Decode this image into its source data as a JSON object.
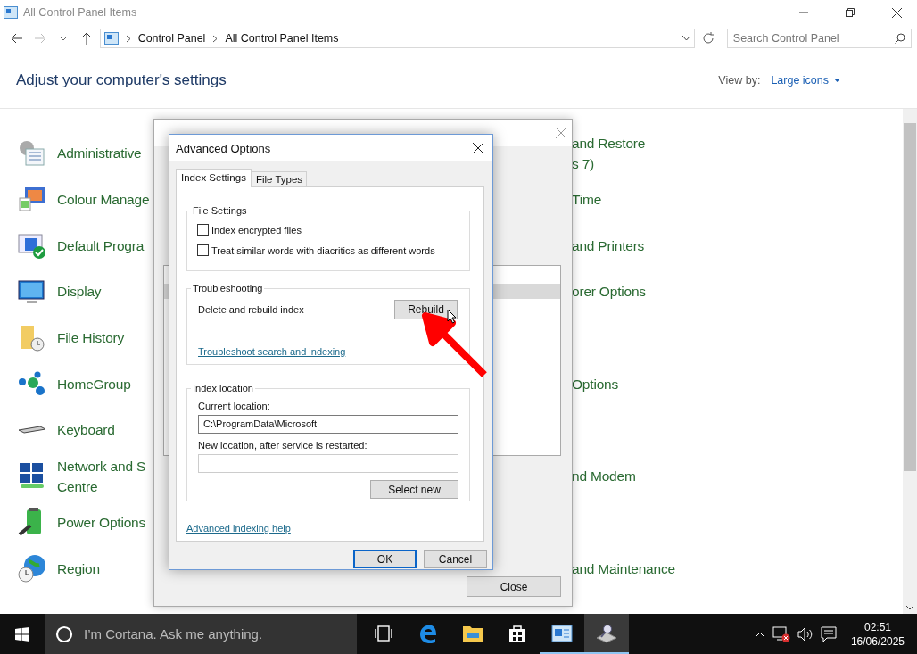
{
  "window": {
    "title": "All Control Panel Items"
  },
  "address_bar": {
    "breadcrumbs": [
      "Control Panel",
      "All Control Panel Items"
    ]
  },
  "search": {
    "placeholder": "Search Control Panel"
  },
  "header": {
    "title": "Adjust your computer's settings",
    "view_by_label": "View by:",
    "view_by_value": "Large icons"
  },
  "rows": [
    {
      "left": {
        "kind": "admin",
        "lines": [
          "Administrative"
        ]
      },
      "right": {
        "lines": [
          "and Restore",
          "s 7)"
        ]
      }
    },
    {
      "left": {
        "kind": "colour",
        "lines": [
          "Colour Manage"
        ]
      },
      "right": {
        "lines": [
          "Time"
        ]
      }
    },
    {
      "left": {
        "kind": "default",
        "lines": [
          "Default Progra"
        ]
      },
      "right": {
        "lines": [
          "and Printers"
        ]
      }
    },
    {
      "left": {
        "kind": "display",
        "lines": [
          "Display"
        ]
      },
      "right": {
        "lines": [
          "orer Options"
        ]
      }
    },
    {
      "left": {
        "kind": "history",
        "lines": [
          "File History"
        ]
      }
    },
    {
      "left": {
        "kind": "homegroup",
        "lines": [
          "HomeGroup"
        ]
      },
      "right": {
        "lines": [
          "Options"
        ]
      }
    },
    {
      "left": {
        "kind": "keyboard",
        "lines": [
          "Keyboard"
        ]
      }
    },
    {
      "left": {
        "kind": "network",
        "lines": [
          "Network and S",
          "Centre"
        ]
      },
      "right": {
        "lines": [
          "nd Modem"
        ]
      }
    },
    {
      "left": {
        "kind": "power",
        "lines": [
          "Power Options"
        ]
      }
    },
    {
      "left": {
        "kind": "region",
        "lines": [
          "Region"
        ]
      },
      "right": {
        "lines": [
          "and Maintenance"
        ]
      }
    }
  ],
  "indexing_options": {
    "close_button": "Close"
  },
  "advanced_options": {
    "title": "Advanced Options",
    "tabs": [
      {
        "label": "Index Settings",
        "selected": true
      },
      {
        "label": "File Types",
        "selected": false
      }
    ],
    "file_settings": {
      "title": "File Settings",
      "options": [
        {
          "label": "Index encrypted files",
          "checked": false
        },
        {
          "label": "Treat similar words with diacritics as different words",
          "checked": false
        }
      ]
    },
    "troubleshooting": {
      "title": "Troubleshooting",
      "text": "Delete and rebuild index",
      "button": "Rebuild",
      "link": "Troubleshoot search and indexing"
    },
    "index_location": {
      "title": "Index location",
      "current_label": "Current location:",
      "current_value": "C:\\ProgramData\\Microsoft",
      "new_label": "New location, after service is restarted:",
      "button": "Select new"
    },
    "help_link": "Advanced indexing help",
    "buttons": [
      {
        "label": "OK",
        "default": true
      },
      {
        "label": "Cancel",
        "default": false
      }
    ]
  },
  "taskbar": {
    "search_placeholder": "I’m Cortana. Ask me anything.",
    "apps": [
      {
        "kind": "taskview",
        "open": false,
        "active": false
      },
      {
        "kind": "edge",
        "open": false,
        "active": false
      },
      {
        "kind": "explorer",
        "open": false,
        "active": false
      },
      {
        "kind": "store",
        "open": false,
        "active": false
      },
      {
        "kind": "controlpanel",
        "open": true,
        "active": false
      },
      {
        "kind": "indexing",
        "open": true,
        "active": true
      }
    ],
    "time": "02:51",
    "date": "16/06/2025"
  }
}
